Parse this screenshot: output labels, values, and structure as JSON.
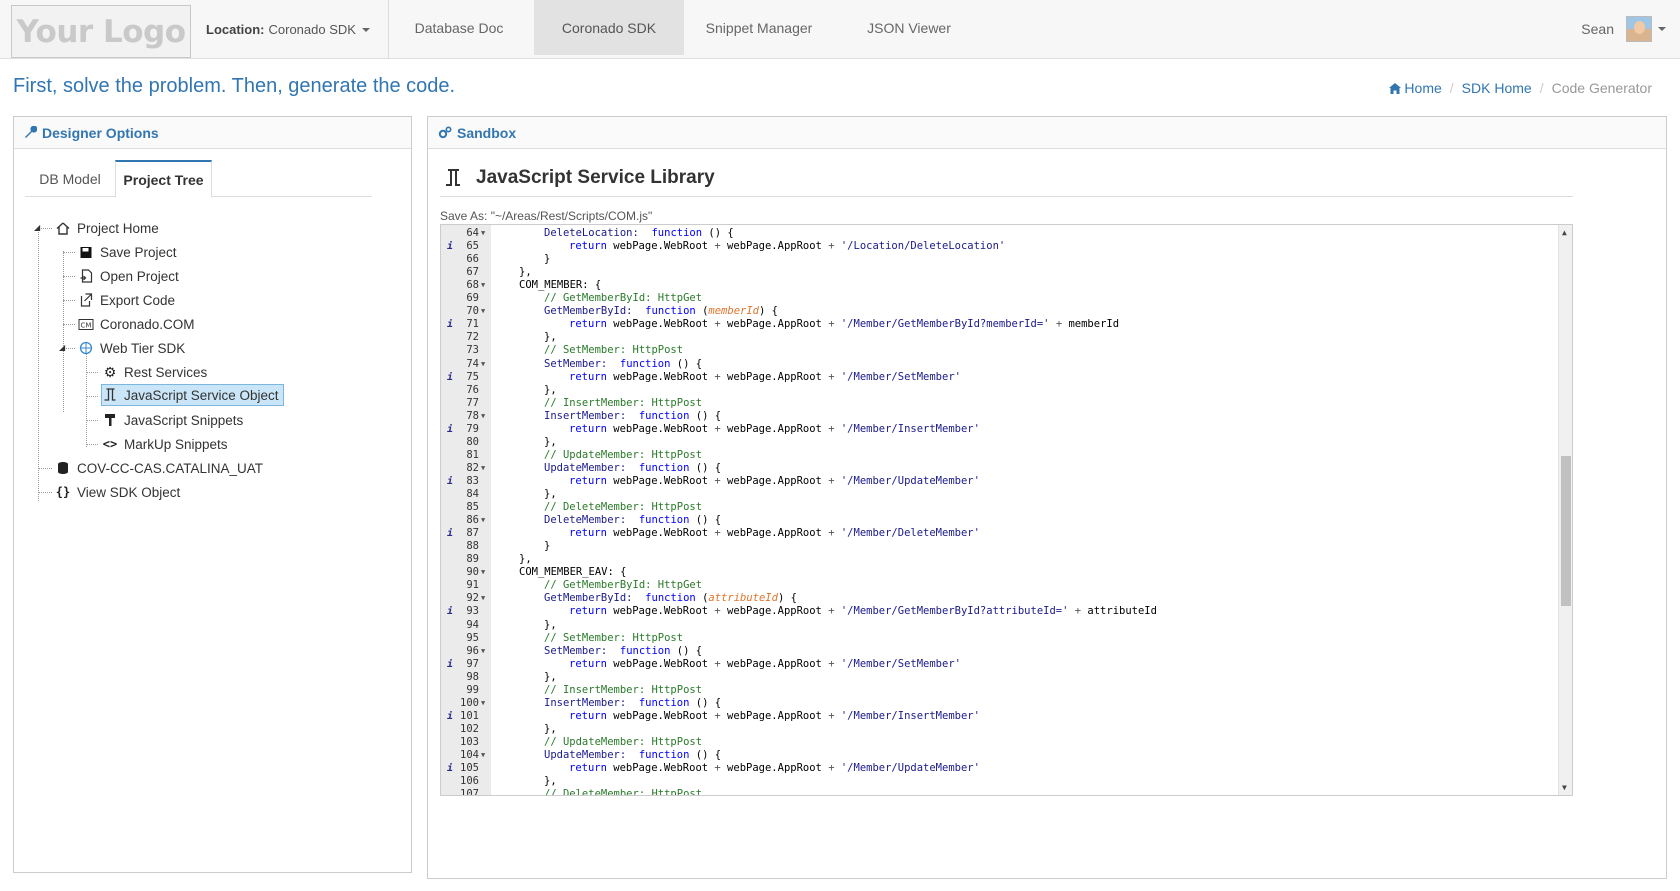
{
  "navbar": {
    "logo": "Your Logo",
    "location_label": "Location:",
    "location_value": "Coronado SDK",
    "tabs": [
      "Database Doc",
      "Coronado SDK",
      "Snippet Manager",
      "JSON Viewer"
    ],
    "active_tab": "Coronado SDK",
    "user": "Sean"
  },
  "header": {
    "tagline": "First, solve the problem. Then, generate the code.",
    "breadcrumb": [
      "Home",
      "SDK Home",
      "Code Generator"
    ]
  },
  "designer": {
    "title": "Designer Options",
    "tabs": [
      "DB Model",
      "Project Tree"
    ],
    "active_tab": "Project Tree",
    "tree": [
      {
        "label": "Project Home",
        "icon": "home-icon",
        "level": 0
      },
      {
        "label": "Save Project",
        "icon": "floppy-icon",
        "level": 1
      },
      {
        "label": "Open Project",
        "icon": "open-file-icon",
        "level": 1
      },
      {
        "label": "Export Code",
        "icon": "export-icon",
        "level": 1
      },
      {
        "label": "Coronado.COM",
        "icon": "com-icon",
        "level": 1
      },
      {
        "label": "Web Tier SDK",
        "icon": "globe-icon",
        "level": 1
      },
      {
        "label": "Rest Services",
        "icon": "gear-icon",
        "level": 2
      },
      {
        "label": "JavaScript Service Object",
        "icon": "js-object-icon",
        "level": 2,
        "selected": true
      },
      {
        "label": "JavaScript Snippets",
        "icon": "hammer-icon",
        "level": 2
      },
      {
        "label": "MarkUp Snippets",
        "icon": "code-brackets-icon",
        "level": 2
      },
      {
        "label": "COV-CC-CAS.CATALINA_UAT",
        "icon": "database-icon",
        "level": 0
      },
      {
        "label": "View SDK Object",
        "icon": "braces-icon",
        "level": 0
      }
    ]
  },
  "sandbox": {
    "title": "Sandbox",
    "library_title": "JavaScript Service Library",
    "save_as": "Save As: \"~/Areas/Rest/Scripts/COM.js\""
  },
  "editor": {
    "lines": [
      {
        "n": "64",
        "fold": true,
        "info": false,
        "indent": 2,
        "kind": "fn",
        "name": "DeleteLocation",
        "param": ""
      },
      {
        "n": "65",
        "fold": false,
        "info": true,
        "indent": 3,
        "kind": "ret",
        "path": "'/Location/DeleteLocation'",
        "extra": ""
      },
      {
        "n": "66",
        "fold": false,
        "info": false,
        "indent": 2,
        "kind": "raw",
        "text": "}"
      },
      {
        "n": "67",
        "fold": false,
        "info": false,
        "indent": 1,
        "kind": "raw",
        "text": "},"
      },
      {
        "n": "68",
        "fold": true,
        "info": false,
        "indent": 1,
        "kind": "obj",
        "text": "COM_MEMBER: {"
      },
      {
        "n": "69",
        "fold": false,
        "info": false,
        "indent": 2,
        "kind": "cmt",
        "text": "// GetMemberById: HttpGet"
      },
      {
        "n": "70",
        "fold": true,
        "info": false,
        "indent": 2,
        "kind": "fn",
        "name": "GetMemberById",
        "param": "memberId"
      },
      {
        "n": "71",
        "fold": false,
        "info": true,
        "indent": 3,
        "kind": "ret",
        "path": "'/Member/GetMemberById?memberId='",
        "extra": "memberId"
      },
      {
        "n": "72",
        "fold": false,
        "info": false,
        "indent": 2,
        "kind": "raw",
        "text": "},"
      },
      {
        "n": "73",
        "fold": false,
        "info": false,
        "indent": 2,
        "kind": "cmt",
        "text": "// SetMember: HttpPost"
      },
      {
        "n": "74",
        "fold": true,
        "info": false,
        "indent": 2,
        "kind": "fn",
        "name": "SetMember",
        "param": ""
      },
      {
        "n": "75",
        "fold": false,
        "info": true,
        "indent": 3,
        "kind": "ret",
        "path": "'/Member/SetMember'",
        "extra": ""
      },
      {
        "n": "76",
        "fold": false,
        "info": false,
        "indent": 2,
        "kind": "raw",
        "text": "},"
      },
      {
        "n": "77",
        "fold": false,
        "info": false,
        "indent": 2,
        "kind": "cmt",
        "text": "// InsertMember: HttpPost"
      },
      {
        "n": "78",
        "fold": true,
        "info": false,
        "indent": 2,
        "kind": "fn",
        "name": "InsertMember",
        "param": ""
      },
      {
        "n": "79",
        "fold": false,
        "info": true,
        "indent": 3,
        "kind": "ret",
        "path": "'/Member/InsertMember'",
        "extra": ""
      },
      {
        "n": "80",
        "fold": false,
        "info": false,
        "indent": 2,
        "kind": "raw",
        "text": "},"
      },
      {
        "n": "81",
        "fold": false,
        "info": false,
        "indent": 2,
        "kind": "cmt",
        "text": "// UpdateMember: HttpPost"
      },
      {
        "n": "82",
        "fold": true,
        "info": false,
        "indent": 2,
        "kind": "fn",
        "name": "UpdateMember",
        "param": ""
      },
      {
        "n": "83",
        "fold": false,
        "info": true,
        "indent": 3,
        "kind": "ret",
        "path": "'/Member/UpdateMember'",
        "extra": ""
      },
      {
        "n": "84",
        "fold": false,
        "info": false,
        "indent": 2,
        "kind": "raw",
        "text": "},"
      },
      {
        "n": "85",
        "fold": false,
        "info": false,
        "indent": 2,
        "kind": "cmt",
        "text": "// DeleteMember: HttpPost"
      },
      {
        "n": "86",
        "fold": true,
        "info": false,
        "indent": 2,
        "kind": "fn",
        "name": "DeleteMember",
        "param": ""
      },
      {
        "n": "87",
        "fold": false,
        "info": true,
        "indent": 3,
        "kind": "ret",
        "path": "'/Member/DeleteMember'",
        "extra": ""
      },
      {
        "n": "88",
        "fold": false,
        "info": false,
        "indent": 2,
        "kind": "raw",
        "text": "}"
      },
      {
        "n": "89",
        "fold": false,
        "info": false,
        "indent": 1,
        "kind": "raw",
        "text": "},"
      },
      {
        "n": "90",
        "fold": true,
        "info": false,
        "indent": 1,
        "kind": "obj",
        "text": "COM_MEMBER_EAV: {"
      },
      {
        "n": "91",
        "fold": false,
        "info": false,
        "indent": 2,
        "kind": "cmt",
        "text": "// GetMemberById: HttpGet"
      },
      {
        "n": "92",
        "fold": true,
        "info": false,
        "indent": 2,
        "kind": "fn",
        "name": "GetMemberById",
        "param": "attributeId"
      },
      {
        "n": "93",
        "fold": false,
        "info": true,
        "indent": 3,
        "kind": "ret",
        "path": "'/Member/GetMemberById?attributeId='",
        "extra": "attributeId"
      },
      {
        "n": "94",
        "fold": false,
        "info": false,
        "indent": 2,
        "kind": "raw",
        "text": "},"
      },
      {
        "n": "95",
        "fold": false,
        "info": false,
        "indent": 2,
        "kind": "cmt",
        "text": "// SetMember: HttpPost"
      },
      {
        "n": "96",
        "fold": true,
        "info": false,
        "indent": 2,
        "kind": "fn",
        "name": "SetMember",
        "param": ""
      },
      {
        "n": "97",
        "fold": false,
        "info": true,
        "indent": 3,
        "kind": "ret",
        "path": "'/Member/SetMember'",
        "extra": ""
      },
      {
        "n": "98",
        "fold": false,
        "info": false,
        "indent": 2,
        "kind": "raw",
        "text": "},"
      },
      {
        "n": "99",
        "fold": false,
        "info": false,
        "indent": 2,
        "kind": "cmt",
        "text": "// InsertMember: HttpPost"
      },
      {
        "n": "100",
        "fold": true,
        "info": false,
        "indent": 2,
        "kind": "fn",
        "name": "InsertMember",
        "param": ""
      },
      {
        "n": "101",
        "fold": false,
        "info": true,
        "indent": 3,
        "kind": "ret",
        "path": "'/Member/InsertMember'",
        "extra": ""
      },
      {
        "n": "102",
        "fold": false,
        "info": false,
        "indent": 2,
        "kind": "raw",
        "text": "},"
      },
      {
        "n": "103",
        "fold": false,
        "info": false,
        "indent": 2,
        "kind": "cmt",
        "text": "// UpdateMember: HttpPost"
      },
      {
        "n": "104",
        "fold": true,
        "info": false,
        "indent": 2,
        "kind": "fn",
        "name": "UpdateMember",
        "param": ""
      },
      {
        "n": "105",
        "fold": false,
        "info": true,
        "indent": 3,
        "kind": "ret",
        "path": "'/Member/UpdateMember'",
        "extra": ""
      },
      {
        "n": "106",
        "fold": false,
        "info": false,
        "indent": 2,
        "kind": "raw",
        "text": "},"
      },
      {
        "n": "107",
        "fold": false,
        "info": false,
        "indent": 2,
        "kind": "cmt",
        "text": "// DeleteMember: HttpPost"
      }
    ],
    "tokens": {
      "function": "function",
      "return": "return",
      "web_root": "webPage.WebRoot",
      "app_root": "webPage.AppRoot",
      "plus": "+"
    }
  },
  "colors": {
    "accent": "#3276b1",
    "selected_bg": "#c9e5f7",
    "comment": "#2a7a2a",
    "keyword": "#0000ff",
    "param": "#e0742b"
  }
}
